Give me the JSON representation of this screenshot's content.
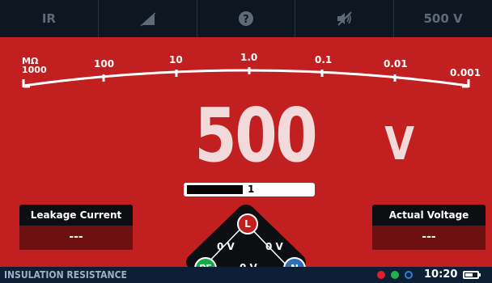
{
  "toolbar": {
    "mode_label": "IR",
    "voltage_label": "500 V",
    "icons": [
      "ramp-icon",
      "help-icon",
      "sound-muted-icon"
    ]
  },
  "scale": {
    "unit": "MΩ",
    "labels": [
      "1000",
      "100",
      "10",
      "1.0",
      "0.1",
      "0.01",
      "0.001"
    ]
  },
  "reading": {
    "value": "500",
    "unit": "V"
  },
  "progress": {
    "label": "1",
    "fraction": 0.45
  },
  "leakage": {
    "title": "Leakage Current",
    "value": "---"
  },
  "actual": {
    "title": "Actual Voltage",
    "value": "---"
  },
  "terminals": {
    "l": "L",
    "pe": "PE",
    "n": "N",
    "l_pe": "0 V",
    "l_n": "0 V",
    "pe_n": "0 V",
    "colors": {
      "l": "#c0201f",
      "pe": "#1aa84a",
      "n": "#2f6fb8"
    }
  },
  "status": {
    "mode": "INSULATION RESISTANCE",
    "time": "10:20",
    "dots": [
      "#e0202a",
      "#22b24c",
      "#2f80d8"
    ]
  }
}
